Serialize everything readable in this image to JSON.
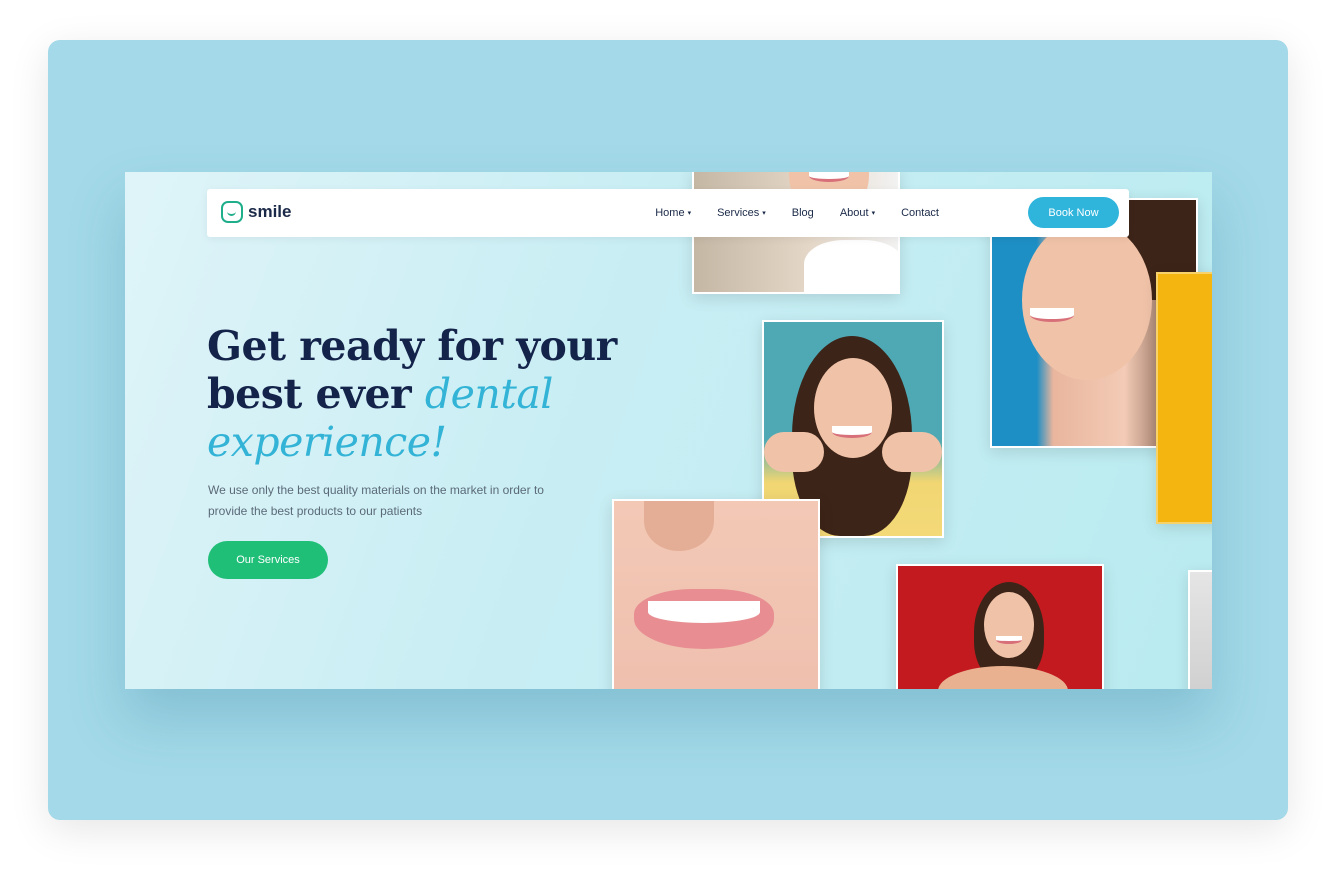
{
  "nav": {
    "logo_text": "smile",
    "items": [
      {
        "label": "Home",
        "has_caret": true
      },
      {
        "label": "Services",
        "has_caret": true
      },
      {
        "label": "Blog",
        "has_caret": false
      },
      {
        "label": "About",
        "has_caret": true
      },
      {
        "label": "Contact",
        "has_caret": false
      }
    ],
    "cta_label": "Book Now",
    "caret_glyph": "▾"
  },
  "hero": {
    "title_line1": "Get ready for your",
    "title_line2_plain": "best ever ",
    "title_line2_accent": "dental",
    "title_line3_accent": "experience!",
    "description": "We use only the best quality materials on the market in order to provide the best products to our patients",
    "button_label": "Our Services"
  },
  "colors": {
    "background": "#a3d9e8",
    "brand_green": "#1fbf78",
    "accent_blue": "#2fb5dc",
    "heading_navy": "#14234a"
  }
}
